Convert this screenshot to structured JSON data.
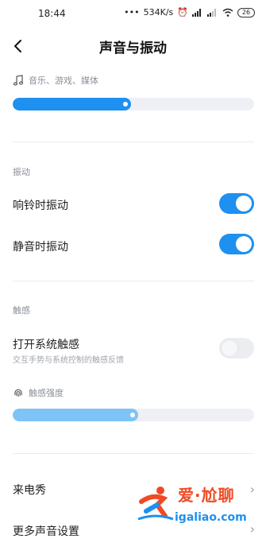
{
  "status_bar": {
    "time": "18:44",
    "net_speed": "534K/s",
    "battery": "26"
  },
  "header": {
    "title": "声音与振动"
  },
  "media": {
    "label": "音乐、游戏、媒体",
    "volume_fraction": 0.49
  },
  "vibration": {
    "section_label": "振动",
    "ring_vibrate": {
      "label": "响铃时振动",
      "on": true
    },
    "silent_vibrate": {
      "label": "静音时振动",
      "on": true
    }
  },
  "haptics": {
    "section_label": "触感",
    "system_haptics": {
      "label": "打开系统触感",
      "sub": "交互手势与系统控制的触感反馈",
      "on": false
    },
    "strength": {
      "label": "触感强度",
      "level_fraction": 0.52
    }
  },
  "items": {
    "caller_show": "来电秀",
    "more_settings": "更多声音设置"
  },
  "watermark": {
    "text": "爱·尬聊",
    "url": "igaliao.com"
  },
  "colors": {
    "accent": "#1e90f0",
    "accent_light": "#7ec3f6",
    "track": "#eef0f5"
  }
}
